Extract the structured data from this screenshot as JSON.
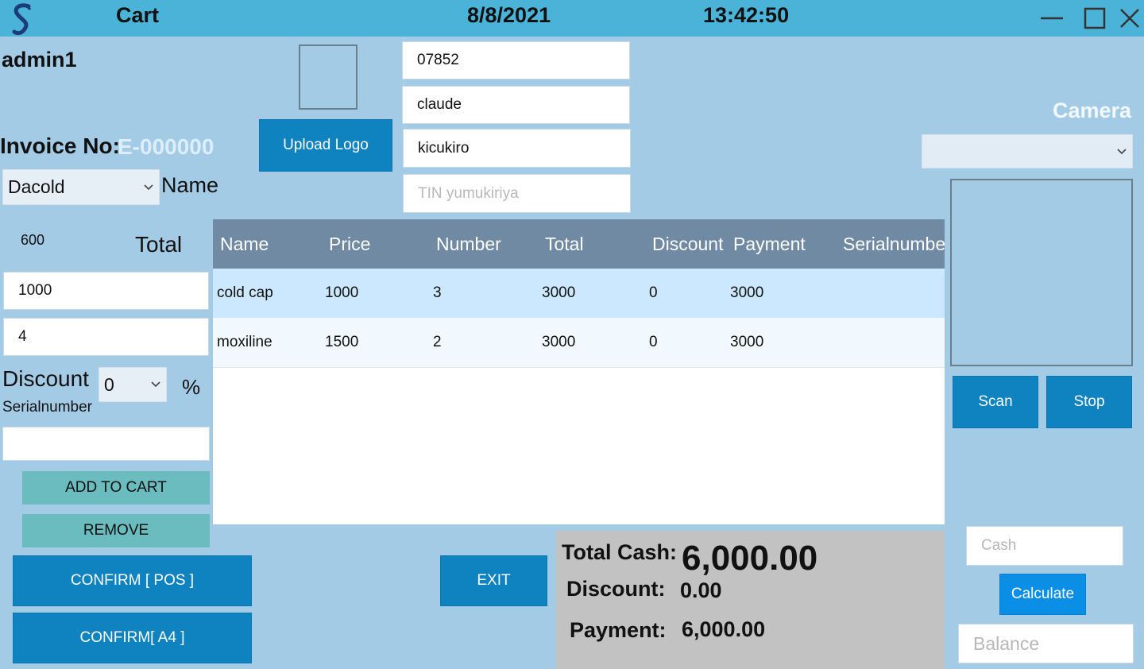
{
  "titlebar": {
    "title": "Cart",
    "date": "8/8/2021",
    "time": "13:42:50",
    "logo_letter": "S"
  },
  "user": {
    "name": "admin1"
  },
  "invoice": {
    "label": "Invoice No:",
    "number": "E-000000"
  },
  "upload_logo_label": "Upload Logo",
  "customer": {
    "phone": "07852",
    "name": "claude",
    "location": "kicukiro",
    "tin_placeholder": "TIN yumukiriya"
  },
  "product": {
    "selected": "Dacold",
    "name_label": "Name",
    "stock": "600",
    "total_label": "Total",
    "price": "1000",
    "quantity": "4",
    "discount_label": "Discount",
    "discount_value": "0",
    "percent_symbol": "%",
    "serial_label": "Serialnumber",
    "serial_value": ""
  },
  "buttons": {
    "add_to_cart": "ADD  TO CART",
    "remove": "REMOVE",
    "confirm_pos": "CONFIRM [ POS ]",
    "confirm_a4": "CONFIRM[ A4 ]",
    "exit": "EXIT",
    "scan": "Scan",
    "stop": "Stop",
    "calculate": "Calculate"
  },
  "table": {
    "columns": [
      "Name",
      "Price",
      "Number",
      "Total",
      "Discount",
      "Payment",
      "Serialnumber"
    ],
    "rows": [
      [
        "cold cap",
        "1000",
        "3",
        "3000",
        "0",
        "3000",
        ""
      ],
      [
        "moxiline",
        "1500",
        "2",
        "3000",
        "0",
        "3000",
        ""
      ]
    ]
  },
  "summary": {
    "total_cash_label": "Total Cash:",
    "total_cash": "6,000.00",
    "discount_label": "Discount:",
    "discount": "0.00",
    "payment_label": "Payment:",
    "payment": "6,000.00"
  },
  "camera": {
    "label": "Camera",
    "selected": ""
  },
  "payment_inputs": {
    "cash_placeholder": "Cash",
    "balance_placeholder": "Balance"
  },
  "colors": {
    "background": "#a4cbe5",
    "titlebar": "#4bb3d8",
    "button_blue": "#0e83bf",
    "button_teal": "#6bbcbf",
    "header_gray": "#6f8aa2",
    "selected_row": "#cce8ff",
    "invoice_text": "#dbeefa"
  }
}
